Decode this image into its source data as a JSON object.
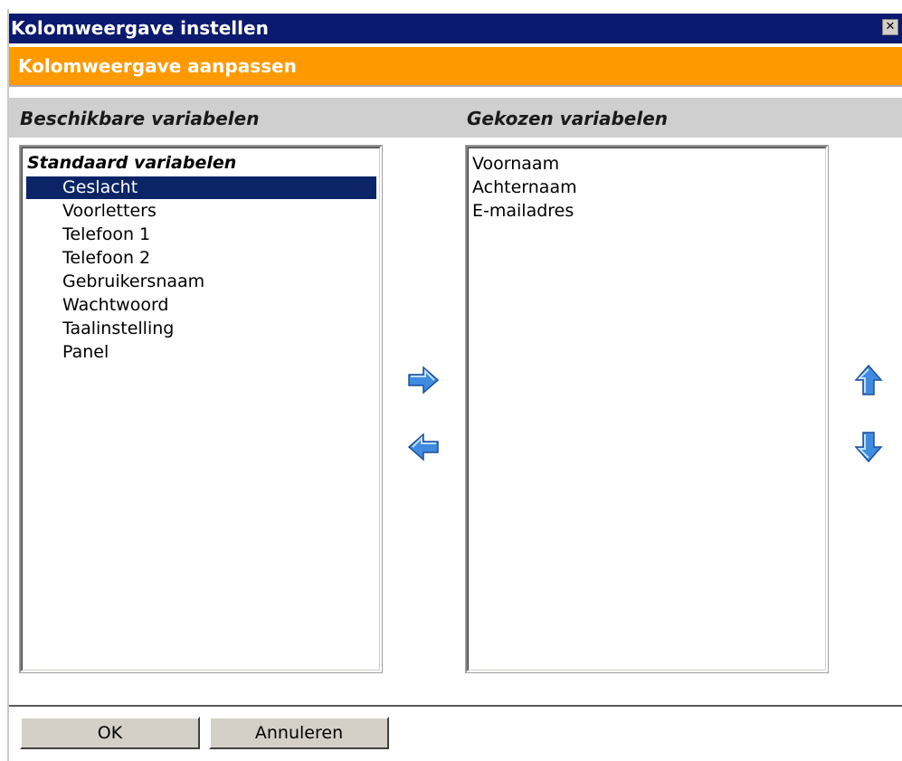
{
  "window": {
    "title": "Kolomweergave instellen",
    "close_label": "✕"
  },
  "subtitle": "Kolomweergave aanpassen",
  "columns": {
    "available_header": "Beschikbare variabelen",
    "selected_header": "Gekozen variabelen"
  },
  "available": {
    "group_label": "Standaard variabelen",
    "items": [
      {
        "label": "Geslacht",
        "selected": true
      },
      {
        "label": "Voorletters"
      },
      {
        "label": "Telefoon 1"
      },
      {
        "label": "Telefoon 2"
      },
      {
        "label": "Gebruikersnaam"
      },
      {
        "label": "Wachtwoord"
      },
      {
        "label": "Taalinstelling"
      },
      {
        "label": "Panel"
      }
    ]
  },
  "selected": {
    "items": [
      {
        "label": "Voornaam"
      },
      {
        "label": "Achternaam"
      },
      {
        "label": "E-mailadres"
      }
    ]
  },
  "icons": {
    "add": "arrow-right-icon",
    "remove": "arrow-left-icon",
    "move_up": "arrow-up-icon",
    "move_down": "arrow-down-icon"
  },
  "colors": {
    "titlebar": "#0b1a6e",
    "subtitle_bar": "#fe9a00",
    "selection": "#0a2466",
    "arrow": "#3f8be0"
  },
  "buttons": {
    "ok": "OK",
    "cancel": "Annuleren"
  }
}
